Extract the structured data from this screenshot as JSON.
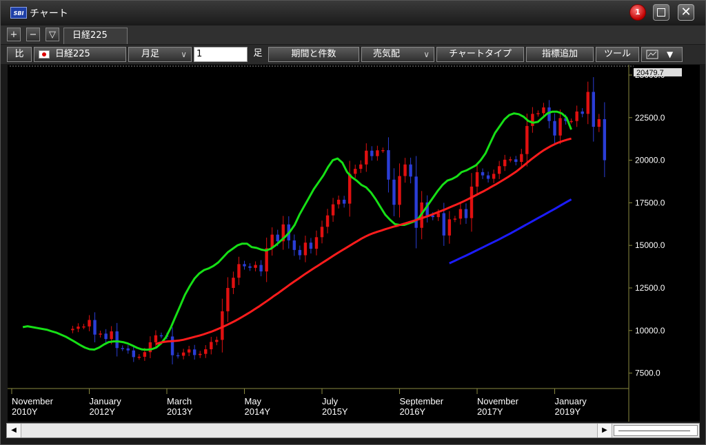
{
  "window": {
    "title": "チャート",
    "logo_text": "SBI",
    "notification_count": "1",
    "close_glyph": "✕"
  },
  "tabs": {
    "plus": "+",
    "minus": "−",
    "menu": "▽",
    "active_tab": "日経225"
  },
  "toolbar": {
    "compare": "比",
    "symbol": "日経225",
    "period": "月足",
    "period_caret": "∨",
    "count_value": "1",
    "count_unit": "足",
    "term_button": "期間と件数",
    "side_select": "売気配",
    "side_caret": "∨",
    "chart_type": "チャートタイプ",
    "add_indicator": "指標追加",
    "tools": "ツール",
    "layout_icon": "layout-icon",
    "layout_caret": "▼"
  },
  "colors": {
    "background": "#000000",
    "up": "#e01010",
    "down": "#2a3dd6",
    "ma_short": "#16e016",
    "ma_mid": "#ff1c1c",
    "ma_long": "#1c1cff",
    "axis": "#8a8a40"
  },
  "scrollbar": {
    "left_arrow": "◀",
    "right_arrow": "▶"
  },
  "chart_data": {
    "type": "line",
    "title": "日経225",
    "price_tag": "20479.7",
    "y_ticks": [
      7500,
      10000,
      12500,
      15000,
      17500,
      20000,
      22500,
      25000
    ],
    "y_tick_labels": [
      "7500.0",
      "10000.0",
      "12500.0",
      "15000.0",
      "17500.0",
      "20000.0",
      "22500.0",
      "25000.0"
    ],
    "ylim": [
      7000,
      25200
    ],
    "x_ticks": [
      {
        "month": "November",
        "year": "2010Y",
        "index": 0
      },
      {
        "month": "January",
        "year": "2012Y",
        "index": 14
      },
      {
        "month": "March",
        "year": "2013Y",
        "index": 28
      },
      {
        "month": "May",
        "year": "2014Y",
        "index": 42
      },
      {
        "month": "July",
        "year": "2015Y",
        "index": 56
      },
      {
        "month": "September",
        "year": "2016Y",
        "index": 70
      },
      {
        "month": "November",
        "year": "2017Y",
        "index": 84
      },
      {
        "month": "January",
        "year": "2019Y",
        "index": 98
      }
    ],
    "x_max_index": 111,
    "series": [
      {
        "name": "close",
        "style": "candles",
        "values": [
          10100,
          10230,
          10240,
          10620,
          9760,
          9820,
          9500,
          9950,
          8970,
          8950,
          8830,
          8440,
          8460,
          8730,
          9310,
          9720,
          9700,
          9650,
          8550,
          8520,
          8710,
          8890,
          8560,
          8630,
          8900,
          9330,
          9450,
          11130,
          12500,
          13100,
          13900,
          13770,
          13680,
          13850,
          13470,
          14830,
          15630,
          15240,
          16230,
          15290,
          14730,
          14420,
          15160,
          14800,
          15480,
          16090,
          16760,
          17410,
          17680,
          17450,
          19200,
          19490,
          19750,
          20560,
          20240,
          20580,
          20590,
          18860,
          17380,
          19070,
          19750,
          19040,
          16030,
          17520,
          16760,
          16660,
          16890,
          15580,
          16530,
          16570,
          17130,
          16600,
          18450,
          19300,
          19110,
          18910,
          19200,
          19650,
          20030,
          20050,
          19900,
          20360,
          22010,
          22720,
          22760,
          23100,
          22300,
          21450,
          22470,
          22300,
          22300,
          22860,
          22720,
          24010,
          21960,
          22410,
          20000
        ]
      },
      {
        "name": "ma_short",
        "values": [
          10200,
          10250,
          10200,
          10150,
          10100,
          10050,
          9960,
          9880,
          9760,
          9640,
          9480,
          9320,
          9150,
          9000,
          8900,
          8880,
          9000,
          9180,
          9320,
          9360,
          9360,
          9320,
          9240,
          9120,
          8980,
          8890,
          8870,
          8900,
          9000,
          9250,
          9600,
          10150,
          10800,
          11450,
          12100,
          12600,
          13050,
          13350,
          13550,
          13650,
          13800,
          14000,
          14300,
          14600,
          14800,
          15000,
          15100,
          15100,
          14900,
          14850,
          14750,
          14700,
          14800,
          15000,
          15250,
          15500,
          15800,
          16200,
          16800,
          17300,
          17800,
          18300,
          18700,
          19100,
          19600,
          20000,
          20100,
          19850,
          19300,
          19000,
          18800,
          18550,
          18400,
          18100,
          17700,
          17250,
          16800,
          16500,
          16250,
          16200,
          16200,
          16300,
          16400,
          16600,
          17000,
          17400,
          17800,
          18200,
          18550,
          18800,
          18900,
          19050,
          19300,
          19400,
          19550,
          19700,
          20000,
          20400,
          21000,
          21600,
          22000,
          22400,
          22650,
          22750,
          22700,
          22550,
          22300,
          22200,
          22250,
          22500,
          22750,
          22850,
          22850,
          22750,
          22500,
          21800
        ]
      },
      {
        "name": "ma_mid",
        "values": [
          9200,
          9280,
          9330,
          9360,
          9380,
          9390,
          9420,
          9460,
          9520,
          9580,
          9640,
          9700,
          9770,
          9850,
          9930,
          10020,
          10120,
          10220,
          10330,
          10440,
          10560,
          10690,
          10820,
          10960,
          11100,
          11250,
          11400,
          11560,
          11720,
          11880,
          12050,
          12210,
          12380,
          12550,
          12720,
          12880,
          13040,
          13200,
          13360,
          13510,
          13660,
          13810,
          13960,
          14110,
          14260,
          14410,
          14560,
          14700,
          14840,
          14980,
          15120,
          15260,
          15400,
          15520,
          15630,
          15720,
          15800,
          15870,
          15950,
          16020,
          16090,
          16150,
          16220,
          16290,
          16360,
          16430,
          16500,
          16580,
          16660,
          16740,
          16830,
          16920,
          17010,
          17100,
          17200,
          17300,
          17400,
          17500,
          17610,
          17720,
          17840,
          17960,
          18080,
          18200,
          18330,
          18460,
          18590,
          18730,
          18870,
          19010,
          19160,
          19320,
          19500,
          19690,
          19880,
          20070,
          20250,
          20420,
          20580,
          20720,
          20850,
          20960,
          21060,
          21140,
          21210,
          21270
        ]
      },
      {
        "name": "ma_long",
        "values": [
          13950,
          14100,
          14250,
          14400,
          14560,
          14720,
          14880,
          15040,
          15200,
          15360,
          15530,
          15700,
          15880,
          16060,
          16240,
          16420,
          16600,
          16780,
          16960,
          17140,
          17330,
          17520,
          17700
        ]
      }
    ]
  }
}
